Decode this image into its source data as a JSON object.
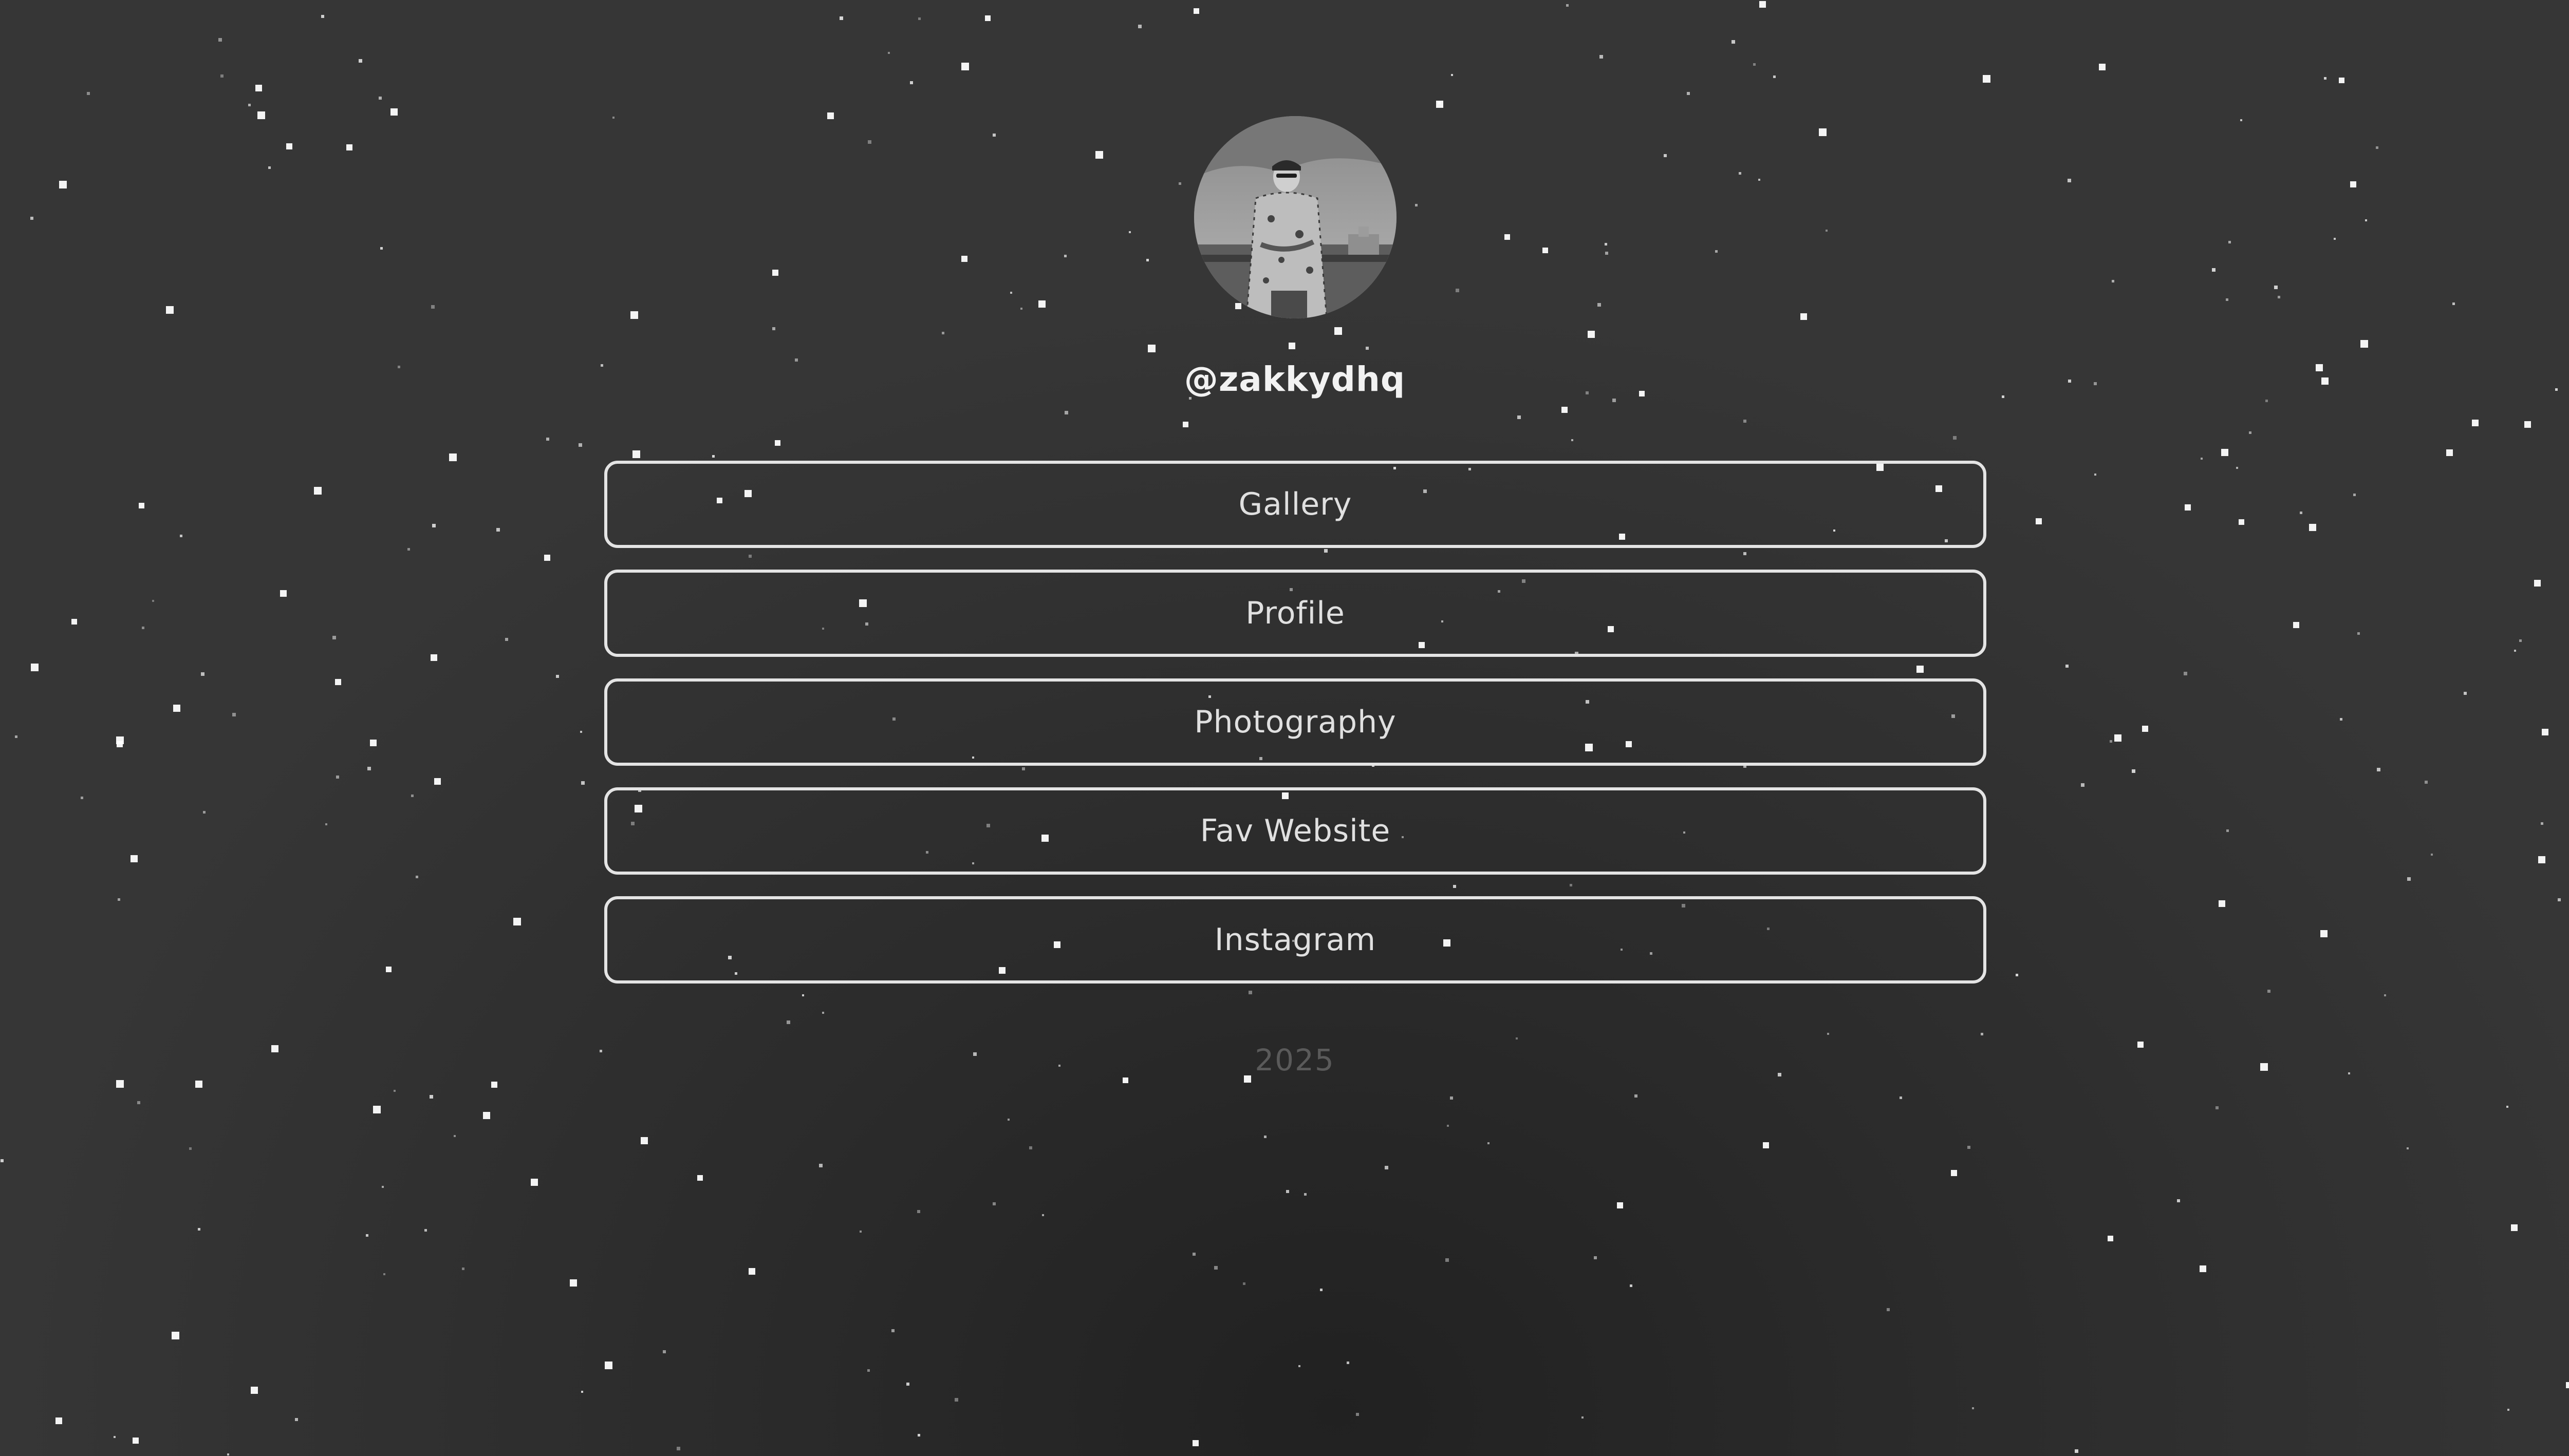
{
  "profile": {
    "avatar_alt": "profile photo",
    "username": "@zakkydhq"
  },
  "links": [
    {
      "label": "Gallery"
    },
    {
      "label": "Profile"
    },
    {
      "label": "Photography"
    },
    {
      "label": "Fav Website"
    },
    {
      "label": "Instagram"
    }
  ],
  "footer": {
    "year": "2025"
  },
  "theme": {
    "background": "#2e2e2e",
    "button_border": "#e4e4e4",
    "text": "#e0e0e0",
    "star": "#ffffff"
  }
}
